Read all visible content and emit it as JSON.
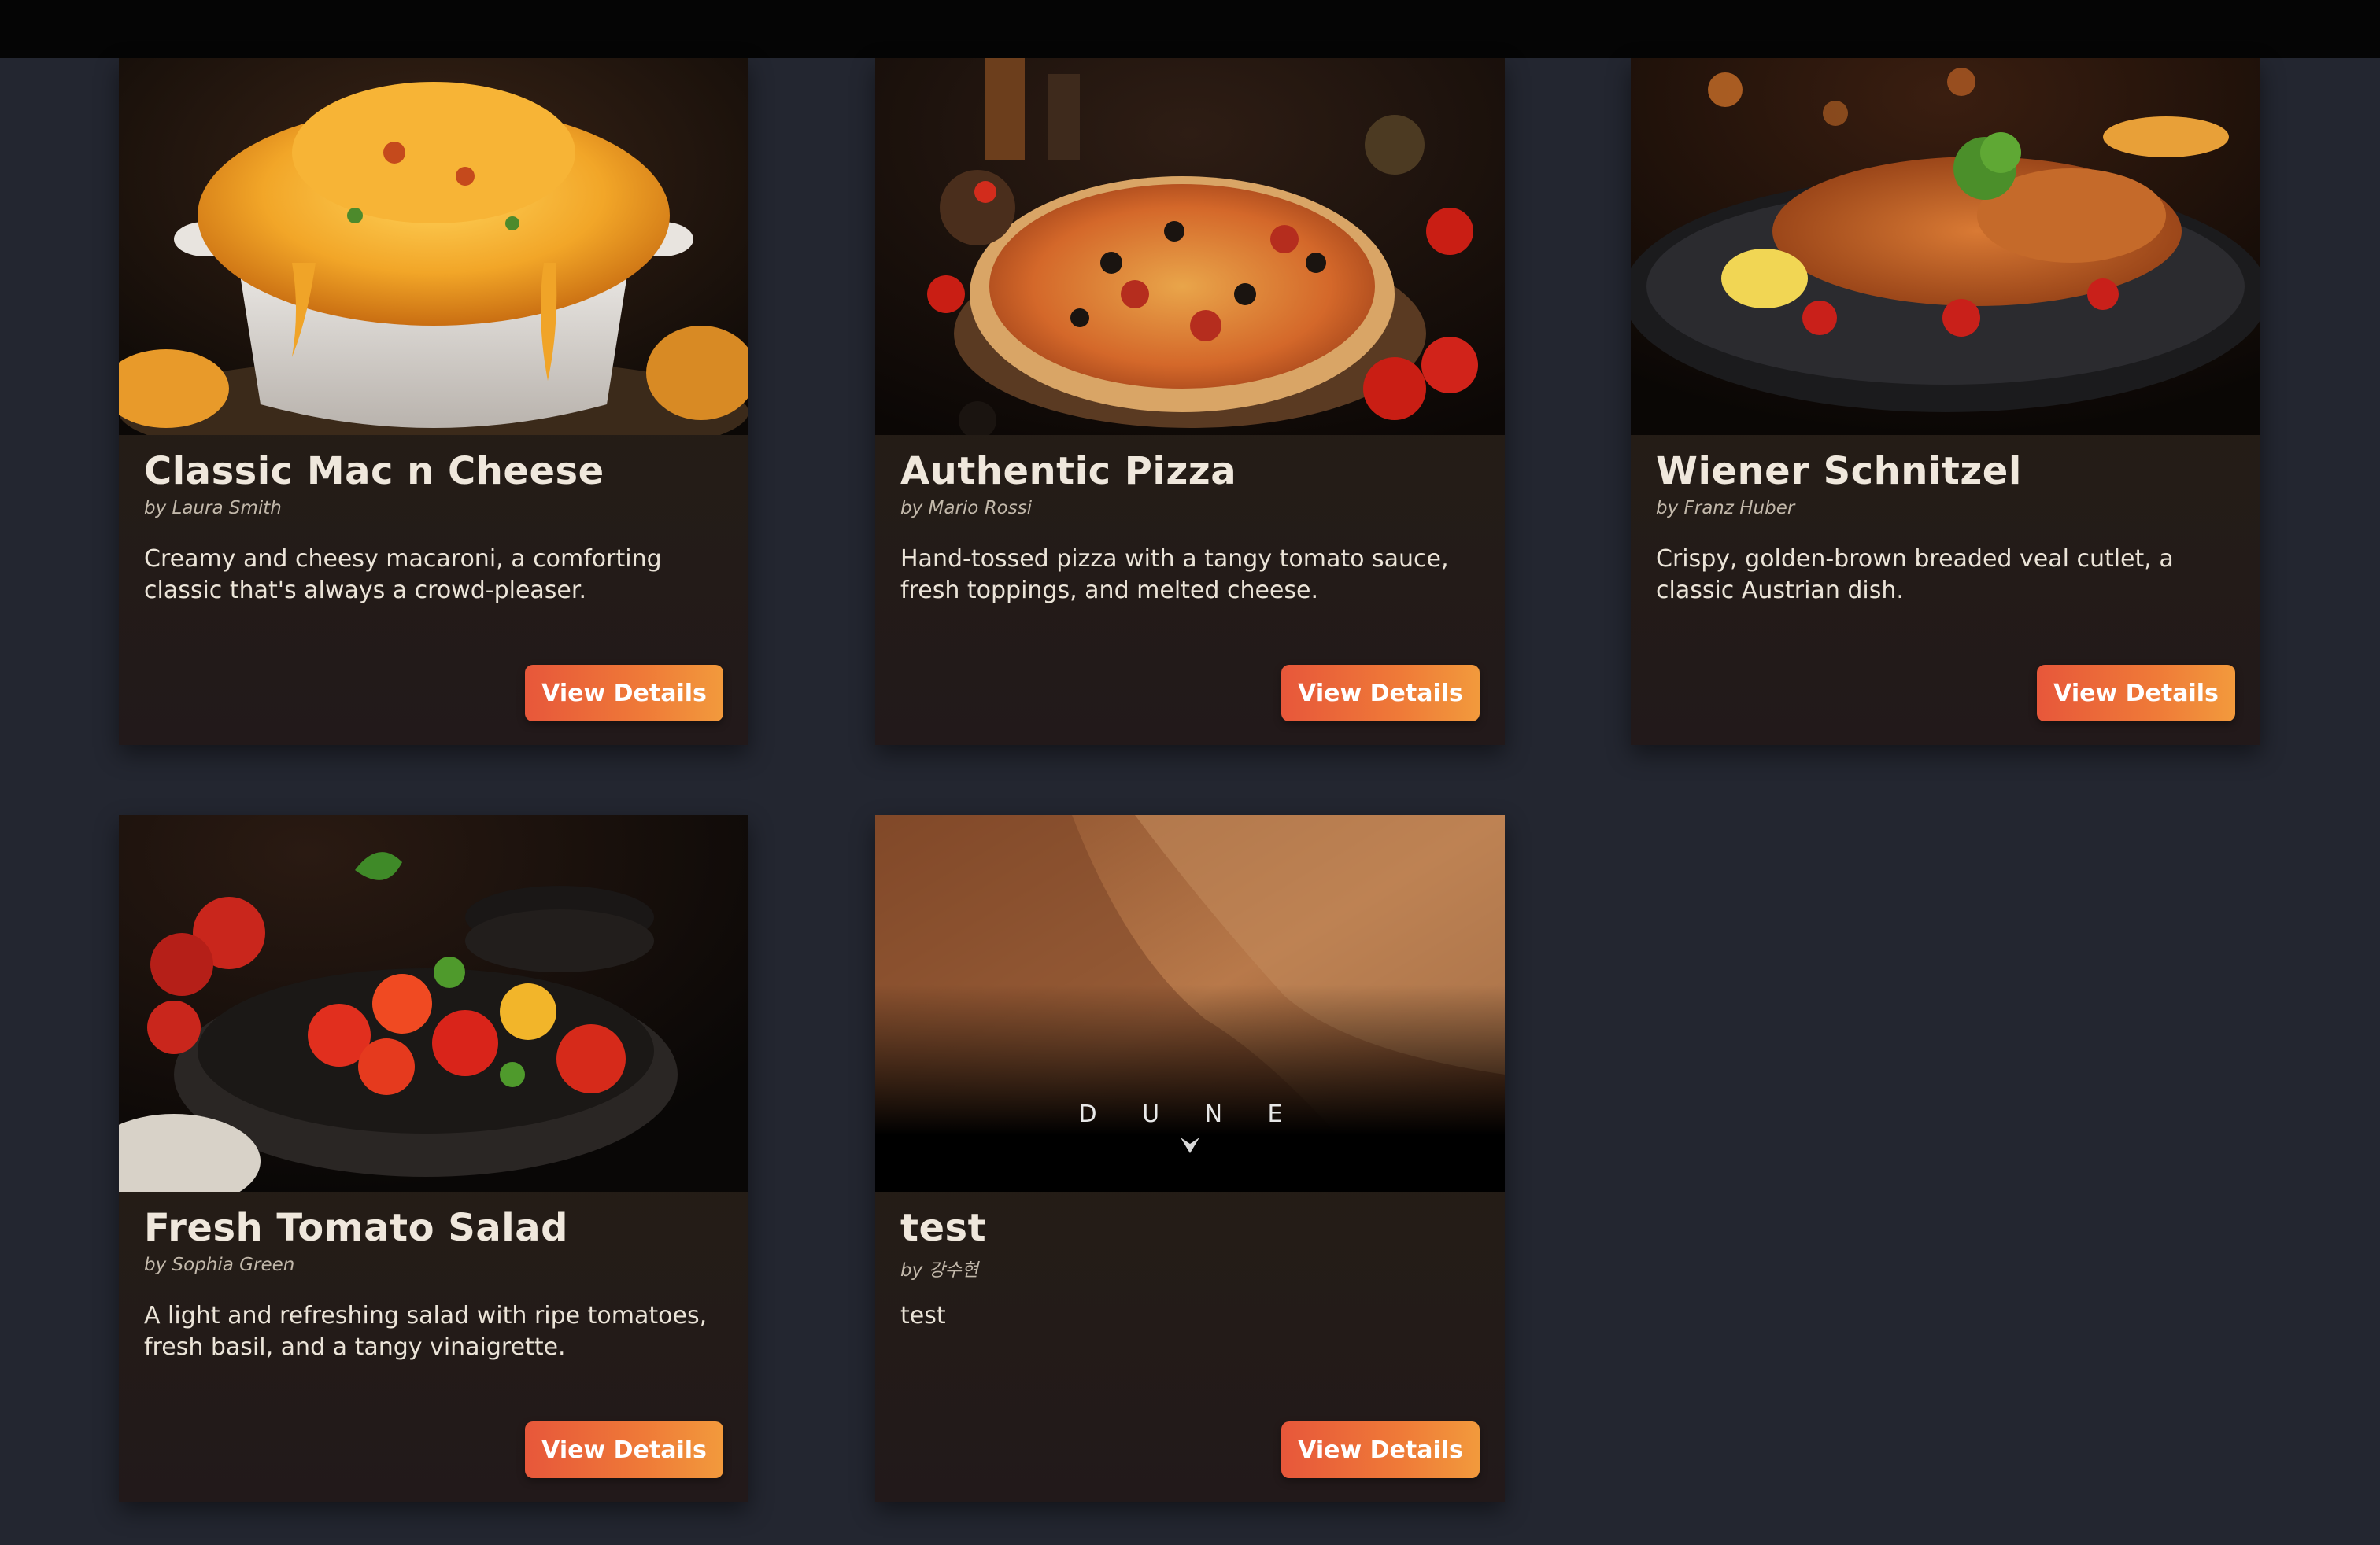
{
  "cards": [
    {
      "title": "Classic Mac n Cheese",
      "author": "by Laura Smith",
      "description": "Creamy and cheesy macaroni, a comforting classic that's always a crowd-pleaser.",
      "button_label": "View Details",
      "image": "mac-and-cheese-photo"
    },
    {
      "title": "Authentic Pizza",
      "author": "by Mario Rossi",
      "description": "Hand-tossed pizza with a tangy tomato sauce, fresh toppings, and melted cheese.",
      "button_label": "View Details",
      "image": "pizza-photo"
    },
    {
      "title": "Wiener Schnitzel",
      "author": "by Franz Huber",
      "description": "Crispy, golden-brown breaded veal cutlet, a classic Austrian dish.",
      "button_label": "View Details",
      "image": "schnitzel-photo"
    },
    {
      "title": "Fresh Tomato Salad",
      "author": "by Sophia Green",
      "description": "A light and refreshing salad with ripe tomatoes, fresh basil, and a tangy vinaigrette.",
      "button_label": "View Details",
      "image": "tomato-salad-photo"
    },
    {
      "title": "test",
      "author": "by 강수현",
      "description": "test",
      "button_label": "View Details",
      "image": "dune-poster",
      "image_text": "D U N E"
    }
  ],
  "colors": {
    "page_background": "#232630",
    "top_bar": "#050505",
    "card_background": "#241d16",
    "button_gradient_start": "#e7573a",
    "button_gradient_end": "#f29a3c"
  }
}
